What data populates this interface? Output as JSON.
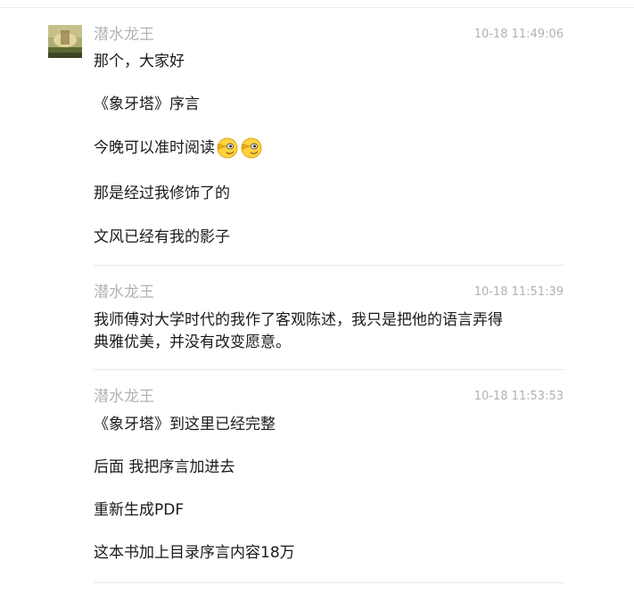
{
  "messages": [
    {
      "sender": "潜水龙王",
      "time": "10-18 11:49:06",
      "lines": [
        "那个，大家好",
        "《象牙塔》序言",
        "今晚可以准时阅读",
        "那是经过我修饰了的",
        "文风已经有我的影子"
      ],
      "emoji": "smirk-emoji"
    },
    {
      "sender": "潜水龙王",
      "time": "10-18 11:51:39",
      "lines": [
        "我师傅对大学时代的我作了客观陈述，我只是把他的语言弄得",
        "典雅优美，并没有改变愿意。"
      ]
    },
    {
      "sender": "潜水龙王",
      "time": "10-18 11:53:53",
      "lines": [
        "《象牙塔》到这里已经完整",
        "后面 我把序言加进去",
        "重新生成PDF",
        "这本书加上目录序言内容18万"
      ]
    }
  ]
}
